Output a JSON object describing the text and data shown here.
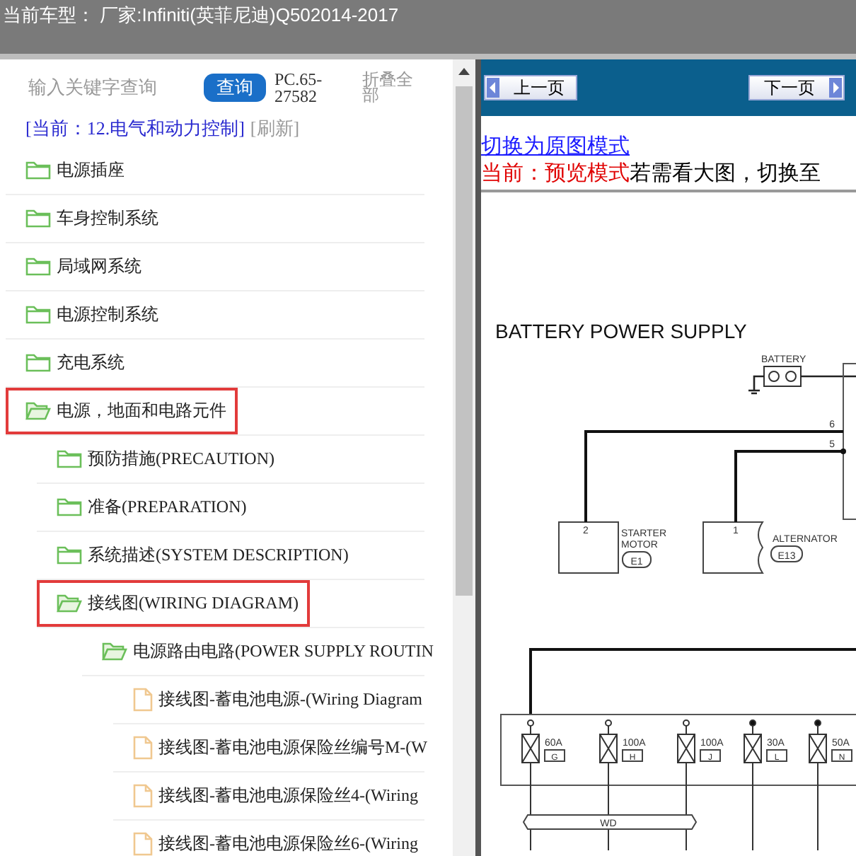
{
  "header": {
    "title": "当前车型： 厂家:Infiniti(英菲尼迪)Q502014-2017"
  },
  "search": {
    "placeholder": "输入关键字查询",
    "button": "查询",
    "code": "PC.65-27582",
    "collapse_all": "折叠全部"
  },
  "current": {
    "path": "[当前：12.电气和动力控制]",
    "refresh": "[刷新]"
  },
  "tree": [
    {
      "label": "电源插座",
      "kind": "folder",
      "expanded": false,
      "highlighted": false
    },
    {
      "label": "车身控制系统",
      "kind": "folder",
      "expanded": false,
      "highlighted": false
    },
    {
      "label": "局域网系统",
      "kind": "folder",
      "expanded": false,
      "highlighted": false
    },
    {
      "label": "电源控制系统",
      "kind": "folder",
      "expanded": false,
      "highlighted": false
    },
    {
      "label": "充电系统",
      "kind": "folder",
      "expanded": false,
      "highlighted": false
    },
    {
      "label": "电源，地面和电路元件",
      "kind": "folder",
      "expanded": true,
      "highlighted": true,
      "children": [
        {
          "label": "预防措施(PRECAUTION)",
          "kind": "folder",
          "expanded": false,
          "highlighted": false
        },
        {
          "label": "准备(PREPARATION)",
          "kind": "folder",
          "expanded": false,
          "highlighted": false
        },
        {
          "label": "系统描述(SYSTEM DESCRIPTION)",
          "kind": "folder",
          "expanded": false,
          "highlighted": false
        },
        {
          "label": "接线图(WIRING DIAGRAM)",
          "kind": "folder",
          "expanded": true,
          "highlighted": true,
          "children": [
            {
              "label": "电源路由电路(POWER SUPPLY ROUTIN",
              "kind": "folder",
              "expanded": true,
              "highlighted": false,
              "children": [
                {
                  "label": "接线图-蓄电池电源-(Wiring Diagram",
                  "kind": "file"
                },
                {
                  "label": "接线图-蓄电池电源保险丝编号M-(W",
                  "kind": "file"
                },
                {
                  "label": "接线图-蓄电池电源保险丝4-(Wiring",
                  "kind": "file"
                },
                {
                  "label": "接线图-蓄电池电源保险丝6-(Wiring",
                  "kind": "file"
                }
              ]
            }
          ]
        }
      ]
    }
  ],
  "viewer": {
    "prev_button": "上一页",
    "next_button": "下一页",
    "mode_link": "切换为原图模式",
    "mode_current": "当前：预览模式",
    "mode_hint": "若需看大图，切换至"
  },
  "diagram": {
    "title": "BATTERY POWER SUPPLY",
    "battery": "BATTERY",
    "wire_labels": [
      "6",
      "5"
    ],
    "components": [
      {
        "pin": "2",
        "name": "STARTER",
        "name_2": "MOTOR",
        "connector": "E1"
      },
      {
        "pin": "1",
        "name": "ALTERNATOR",
        "connector": "E13"
      }
    ],
    "fuses": [
      {
        "rating": "60A",
        "letter": "G",
        "open": true
      },
      {
        "rating": "100A",
        "letter": "H",
        "open": true
      },
      {
        "rating": "100A",
        "letter": "J",
        "open": true
      },
      {
        "rating": "30A",
        "letter": "L",
        "open": false
      },
      {
        "rating": "50A",
        "letter": "N",
        "open": false
      }
    ],
    "harness": "WD"
  }
}
